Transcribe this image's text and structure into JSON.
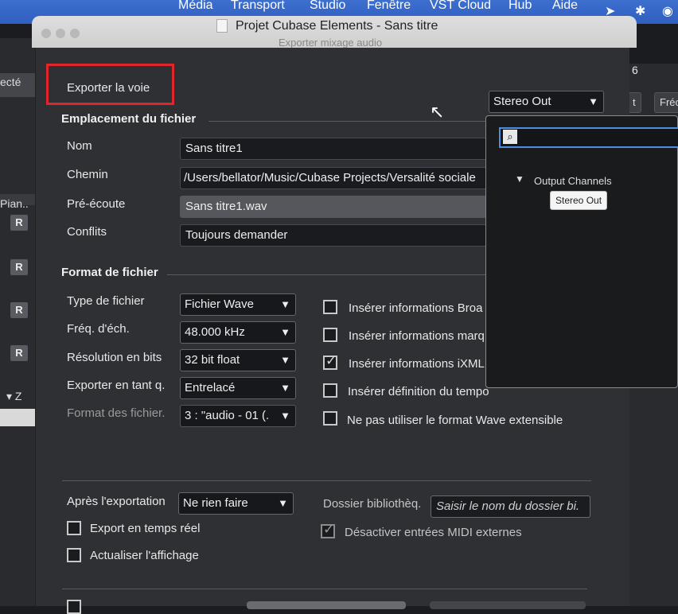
{
  "menubar": {
    "items": [
      "Média",
      "Transport",
      "Studio",
      "Fenêtre",
      "VST Cloud",
      "Hub",
      "Aide"
    ],
    "icons": [
      "location-icon",
      "bluetooth-icon",
      "user-icon"
    ]
  },
  "bg_left": {
    "label_top": "ecté",
    "label_track": "Pian..",
    "r_buttons": [
      "R",
      "R",
      "R",
      "R"
    ],
    "bottom": "▾  Z"
  },
  "bg_right": {
    "number": "6",
    "btn1": "t",
    "btn2": "Fréc"
  },
  "dialog": {
    "title": "Projet Cubase Elements - Sans titre",
    "subtitle": "Exporter mixage audio",
    "export_voice_label": "Exporter la voie",
    "output_selected": "Stereo Out",
    "file_location": {
      "heading": "Emplacement du fichier",
      "name_label": "Nom",
      "name_value": "Sans titre1",
      "path_label": "Chemin",
      "path_value": "/Users/bellator/Music/Cubase Projects/Versalité sociale",
      "preview_label": "Pré-écoute",
      "preview_value": "Sans titre1.wav",
      "conflicts_label": "Conflits",
      "conflicts_value": "Toujours demander"
    },
    "file_format": {
      "heading": "Format de fichier",
      "type_label": "Type de fichier",
      "type_value": "Fichier Wave",
      "rate_label": "Fréq. d'éch.",
      "rate_value": "48.000 kHz",
      "bits_label": "Résolution en bits",
      "bits_value": "32 bit float",
      "export_as_label": "Exporter en tant q.",
      "export_as_value": "Entrelacé",
      "format_label": "Format des fichier.",
      "format_value": "3 : \"audio - 01 (.",
      "checkboxes": [
        {
          "label": "Insérer informations Broa",
          "checked": false
        },
        {
          "label": "Insérer informations marq",
          "checked": false
        },
        {
          "label": "Insérer informations iXML",
          "checked": true
        },
        {
          "label": "Insérer définition du tempo",
          "checked": false
        },
        {
          "label": "Ne pas utiliser le format Wave extensible",
          "checked": false
        }
      ]
    },
    "after_export": {
      "label": "Après l'exportation",
      "value": "Ne rien faire",
      "library_label": "Dossier bibliothèq.",
      "library_placeholder": "Saisir le nom du dossier bi.",
      "realtime_label": "Export en temps réel",
      "realtime_checked": false,
      "refresh_label": "Actualiser l'affichage",
      "refresh_checked": false,
      "midi_label": "Désactiver entrées MIDI externes",
      "midi_checked": true
    },
    "popup": {
      "group": "Output Channels",
      "item": "Stereo Out"
    }
  }
}
